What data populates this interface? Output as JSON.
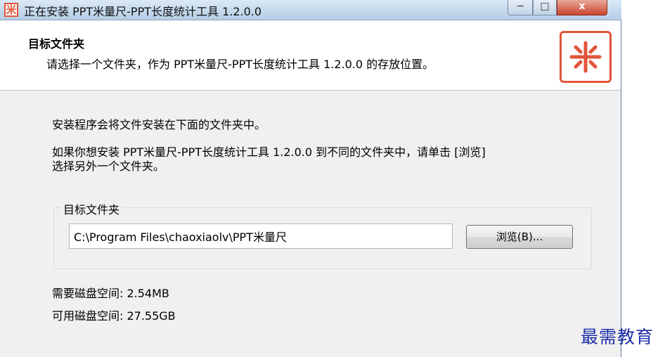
{
  "window": {
    "title": "正在安装 PPT米量尺-PPT长度统计工具 1.2.0.0",
    "app_icon_glyph": "米",
    "controls": {
      "minimize": "−",
      "maximize": "□",
      "close": "x"
    }
  },
  "header": {
    "title": "目标文件夹",
    "subtitle": "请选择一个文件夹，作为 PPT米量尺-PPT长度统计工具 1.2.0.0 的存放位置。",
    "icon": "ppt-ruler-logo-icon",
    "accent_color": "#e2553a"
  },
  "body": {
    "para1": "安装程序会将文件安装在下面的文件夹中。",
    "para2_line1": "如果你想安装 PPT米量尺-PPT长度统计工具 1.2.0.0 到不同的文件夹中，请单击 [浏览]",
    "para2_line2": "选择另外一个文件夹。",
    "group_label": "目标文件夹",
    "path_value": "C:\\Program Files\\chaoxiaolv\\PPT米量尺",
    "browse_label": "浏览(B)...",
    "space_required": "需要磁盘空间: 2.54MB",
    "space_available": "可用磁盘空间: 27.55GB"
  },
  "watermark": "最需教育"
}
